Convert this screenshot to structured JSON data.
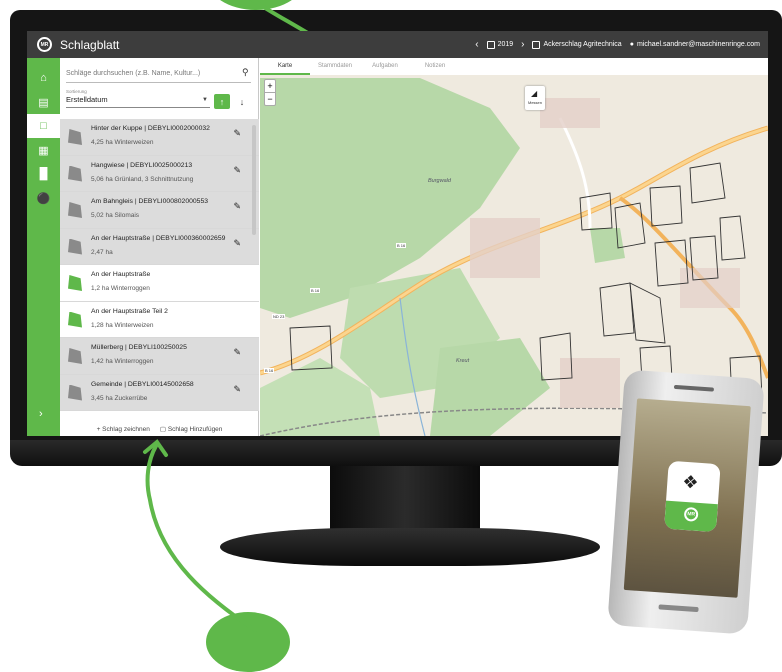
{
  "app": {
    "logo_text": "MR",
    "title": "Schlagblatt"
  },
  "topbar": {
    "prev": "‹",
    "year": "2019",
    "next": "›",
    "company": "Ackerschlag Agritechnica",
    "user": "michael.sandner@maschinenringe.com"
  },
  "nav": {
    "icons": [
      "home-icon",
      "list-icon",
      "clipboard-icon",
      "calendar-icon",
      "chart-icon",
      "tractor-icon"
    ],
    "chevron": "›"
  },
  "search": {
    "placeholder": "Schläge durchsuchen (z.B. Name, Kultur...)"
  },
  "sort": {
    "label": "Sortierung",
    "value": "Erstelldatum"
  },
  "fields": [
    {
      "title": "Hinter der Kuppe | DEBYLI0002000032",
      "sub": "4,25 ha Winterweizen"
    },
    {
      "title": "Hangwiese | DEBYLI0025000213",
      "sub": "5,06 ha Grünland, 3 Schnittnutzung"
    },
    {
      "title": "Am Bahngleis | DEBYLI000802000553",
      "sub": "5,02 ha Silomais"
    },
    {
      "title": "An der Hauptstraße | DEBYLI000360002659",
      "sub": "2,47 ha"
    },
    {
      "title": "An der Hauptstraße",
      "sub": "1,2 ha Winterroggen"
    },
    {
      "title": "An der Hauptstraße Teil 2",
      "sub": "1,28 ha Winterweizen"
    },
    {
      "title": "Müllerberg | DEBYLI100250025",
      "sub": "1,42 ha Winterroggen"
    },
    {
      "title": "Gemeinde | DEBYLI00145002658",
      "sub": "3,45 ha Zuckerrübe"
    }
  ],
  "footer": {
    "draw": "Schlag zeichnen",
    "add": "Schlag Hinzufügen"
  },
  "map": {
    "tabs": [
      "Karte",
      "Stammdaten",
      "Aufgaben",
      "Notizen"
    ],
    "zoom_in": "+",
    "zoom_out": "−",
    "measure": "Messen",
    "labels": [
      "Burgwald",
      "Kreut",
      "B 16",
      "B 16",
      "B 16",
      "ND 23"
    ]
  },
  "colors": {
    "accent": "#5fb84a",
    "appbar": "#3d3d3d"
  }
}
